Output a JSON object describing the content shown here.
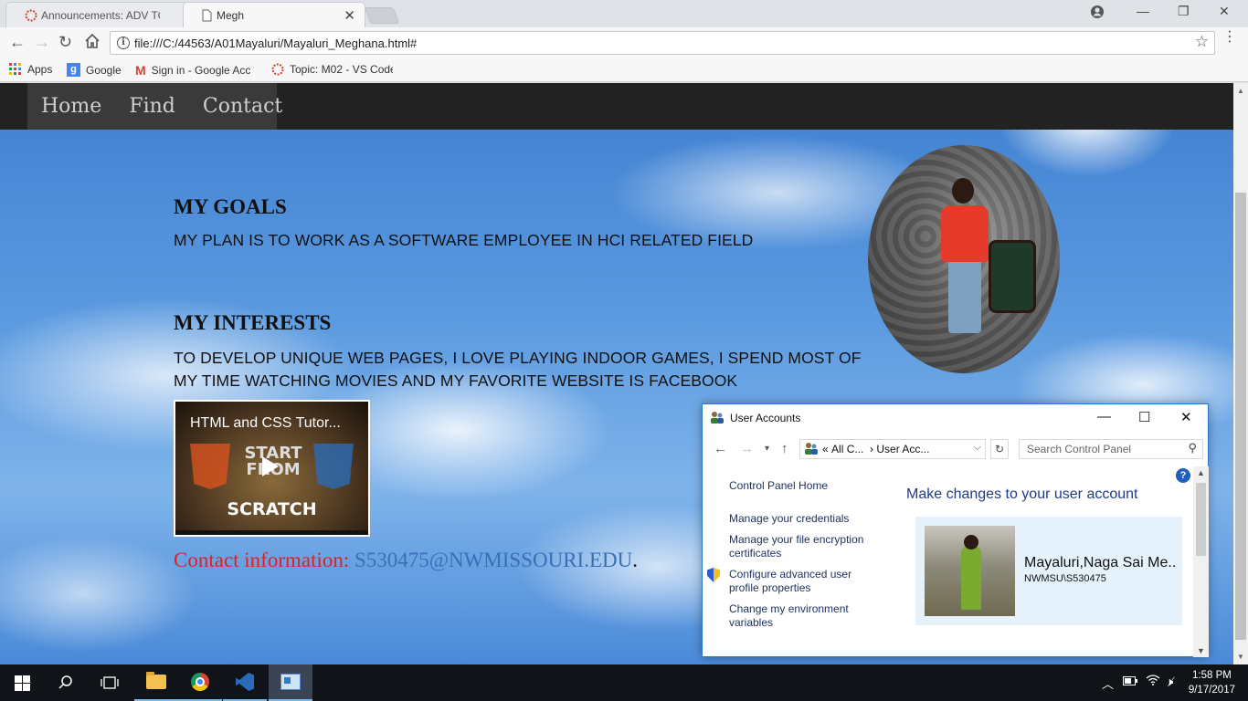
{
  "browser": {
    "tabs": [
      {
        "title": "Announcements: ADV TO",
        "active": false
      },
      {
        "title": "Megh",
        "active": true
      }
    ],
    "url": "file:///C:/44563/A01Mayaluri/Mayaluri_Meghana.html#",
    "bookmarks": [
      {
        "label": "Apps",
        "icon": "apps-grid-icon"
      },
      {
        "label": "Google",
        "icon": "google-icon"
      },
      {
        "label": "Sign in - Google Acc",
        "icon": "gmail-icon"
      },
      {
        "label": "Topic: M02 - VS Code",
        "icon": "canvas-icon"
      }
    ]
  },
  "page": {
    "nav": [
      "Home",
      "Find",
      "Contact"
    ],
    "goals_heading": "MY GOALS",
    "goals_text": "MY PLAN IS TO WORK AS A SOFTWARE EMPLOYEE IN HCI RELATED FIELD",
    "interests_heading": "MY INTERESTS",
    "interests_text": "TO DEVELOP UNIQUE WEB PAGES, I LOVE PLAYING INDOOR GAMES, I SPEND MOST OF MY TIME WATCHING MOVIES AND MY FAVORITE WEBSITE IS FACEBOOK",
    "video": {
      "title": "HTML and CSS Tutor...",
      "thumb_top": "START FROM",
      "thumb_bottom": "SCRATCH"
    },
    "contact_label": "Contact information:",
    "contact_email": "S530475@NWMISSOURI.EDU",
    "contact_end": "."
  },
  "user_accounts": {
    "window_title": "User Accounts",
    "path_prefix": "«",
    "path_1": "All C...",
    "path_sep": "›",
    "path_2": "User Acc...",
    "search_placeholder": "Search Control Panel",
    "links": {
      "home": "Control Panel Home",
      "credentials": "Manage your credentials",
      "encryption": "Manage your file encryption certificates",
      "profile": "Configure advanced user profile properties",
      "environment": "Change my environment variables"
    },
    "heading": "Make changes to your user account",
    "user_name": "Mayaluri,Naga Sai Me...",
    "user_id": "NWMSU\\S530475",
    "help": "?"
  },
  "taskbar": {
    "time": "1:58 PM",
    "date": "9/17/2017"
  }
}
